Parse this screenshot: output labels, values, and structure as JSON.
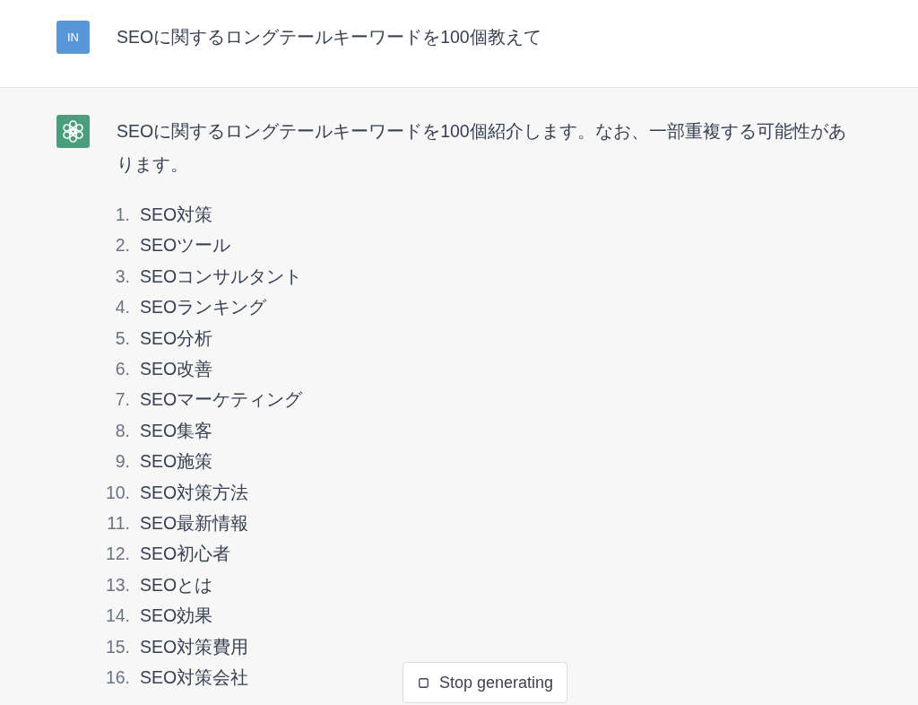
{
  "messages": [
    {
      "kind": "user",
      "avatar": "IN",
      "text": "SEOに関するロングテールキーワードを100個教えて"
    },
    {
      "kind": "assistant",
      "text": "SEOに関するロングテールキーワードを100個紹介します。なお、一部重複する可能性があります。",
      "list": [
        {
          "number": "1.",
          "text": "SEO対策"
        },
        {
          "number": "2.",
          "text": "SEOツール"
        },
        {
          "number": "3.",
          "text": "SEOコンサルタント"
        },
        {
          "number": "4.",
          "text": "SEOランキング"
        },
        {
          "number": "5.",
          "text": "SEO分析"
        },
        {
          "number": "6.",
          "text": "SEO改善"
        },
        {
          "number": "7.",
          "text": "SEOマーケティング"
        },
        {
          "number": "8.",
          "text": "SEO集客"
        },
        {
          "number": "9.",
          "text": "SEO施策"
        },
        {
          "number": "10.",
          "text": "SEO対策方法"
        },
        {
          "number": "11.",
          "text": "SEO最新情報"
        },
        {
          "number": "12.",
          "text": "SEO初心者"
        },
        {
          "number": "13.",
          "text": "SEOとは"
        },
        {
          "number": "14.",
          "text": "SEO効果"
        },
        {
          "number": "15.",
          "text": "SEO対策費用"
        },
        {
          "number": "16.",
          "text": "SEO対策会社"
        }
      ]
    }
  ],
  "stop_button": {
    "label": "Stop generating"
  }
}
